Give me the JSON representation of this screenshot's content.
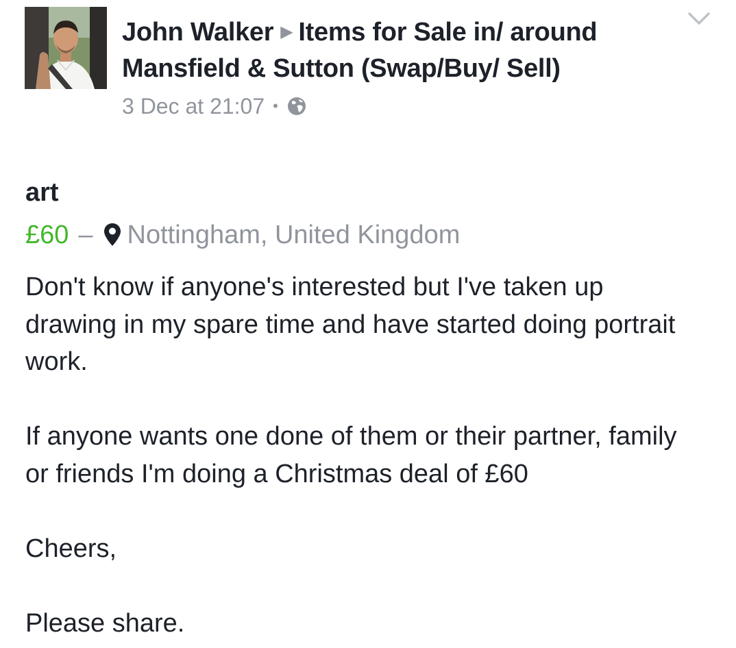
{
  "post": {
    "author_name": "John Walker",
    "group_name": "Items for Sale in/ around Mansfield & Sutton (Swap/Buy/ Sell)",
    "timestamp": "3 Dec at 21:07",
    "separator": "•",
    "privacy_icon": "globe-icon",
    "options_icon": "chevron-down-icon"
  },
  "listing": {
    "title": "art",
    "price": "£60",
    "dash": "–",
    "location_icon": "map-pin-icon",
    "location": "Nottingham, United Kingdom"
  },
  "body": {
    "paragraphs": [
      "Don't know if anyone's interested but I've taken up drawing in my spare time and have started doing portrait work.",
      "If anyone wants one done of them or their partner, family or friends I'm doing a Christmas deal of £60",
      "Cheers,",
      "Please share."
    ]
  },
  "colors": {
    "text": "#1d2129",
    "secondary": "#90949c",
    "price": "#42b72a"
  }
}
